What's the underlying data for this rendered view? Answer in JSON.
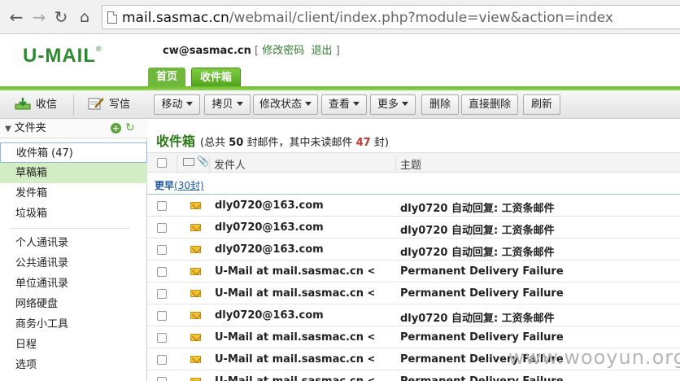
{
  "browser": {
    "url_host": "mail.sasmac.cn",
    "url_path": "/webmail/client/index.php?module=view&action=index",
    "back_icon": "back-arrow-icon",
    "forward_icon": "forward-arrow-icon",
    "reload_icon": "reload-icon",
    "home_icon": "home-icon"
  },
  "header": {
    "logo": "U-MAIL",
    "logo_mark": "®",
    "user_email": "cw@sasmac.cn",
    "bracket_open": "[",
    "bracket_close": "]",
    "change_password": "修改密码",
    "logout": "退出"
  },
  "tabs": [
    {
      "label": "首页"
    },
    {
      "label": "收件箱"
    }
  ],
  "left_toolbar": {
    "receive_label": "收信",
    "write_label": "写信"
  },
  "folders": {
    "header": "文件夹",
    "items": [
      {
        "label": "收件箱 (47)"
      },
      {
        "label": "草稿箱"
      },
      {
        "label": "发件箱"
      },
      {
        "label": "垃圾箱"
      }
    ],
    "tools": [
      {
        "label": "个人通讯录"
      },
      {
        "label": "公共通讯录"
      },
      {
        "label": "单位通讯录"
      },
      {
        "label": "网络硬盘"
      },
      {
        "label": "商务小工具"
      },
      {
        "label": "日程"
      },
      {
        "label": "选项"
      }
    ]
  },
  "toolbar": {
    "move": "移动",
    "copy": "拷贝",
    "modify_status": "修改状态",
    "view": "查看",
    "more": "更多",
    "delete": "删除",
    "direct_delete": "直接删除",
    "refresh": "刷新"
  },
  "mailbox": {
    "title": "收件箱",
    "summary_prefix": "(总共",
    "total": "50",
    "summary_mid": "封邮件，其中未读邮件",
    "unread": "47",
    "summary_suffix": "封)"
  },
  "columns": {
    "sender": "发件人",
    "subject": "主题"
  },
  "group": {
    "label": "更早",
    "count": "(30封)"
  },
  "messages": [
    {
      "from": "dly0720@163.com",
      "subject": "dly0720 自动回复: 工资条邮件"
    },
    {
      "from": "dly0720@163.com",
      "subject": "dly0720 自动回复: 工资条邮件"
    },
    {
      "from": "dly0720@163.com",
      "subject": "dly0720 自动回复: 工资条邮件"
    },
    {
      "from": "U-Mail at mail.sasmac.cn <U-Mail@mail.sasmac.cn>",
      "subject": "Permanent Delivery Failure"
    },
    {
      "from": "U-Mail at mail.sasmac.cn <U-Mail@mail.sasmac.cn>",
      "subject": "Permanent Delivery Failure"
    },
    {
      "from": "dly0720@163.com",
      "subject": "dly0720 自动回复: 工资条邮件"
    },
    {
      "from": "U-Mail at mail.sasmac.cn <U-Mail@mail.sasmac.cn>",
      "subject": "Permanent Delivery Failure"
    },
    {
      "from": "U-Mail at mail.sasmac.cn <U-Mail@mail.sasmac.cn>",
      "subject": "Permanent Delivery Failure"
    },
    {
      "from": "U-Mail at mail.sasmac.cn <U-Mail@mail.sasmac.cn>",
      "subject": "Permanent Delivery Failure"
    }
  ],
  "watermark": "www.wooyun.org",
  "colors": {
    "brand_green": "#2d8a2f",
    "tab_green": "#4ea21c",
    "unread_red": "#c0392b",
    "link_blue": "#1e57a6"
  }
}
